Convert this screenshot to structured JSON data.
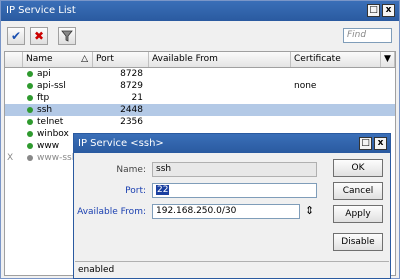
{
  "window": {
    "title": "IP Service List",
    "min_label": "□",
    "close_label": "x"
  },
  "toolbar": {
    "enable_icon": "✔",
    "disable_icon": "✖",
    "filter_icon": "▼",
    "find_placeholder": "Find"
  },
  "table": {
    "columns": [
      "Name",
      "Port",
      "Available From",
      "Certificate"
    ],
    "sort_indicator": "△",
    "dropdown_glyph": "▼",
    "rows": [
      {
        "flag": "",
        "name": "api",
        "port": "8728",
        "from": "",
        "cert": "",
        "status": "enabled"
      },
      {
        "flag": "",
        "name": "api-ssl",
        "port": "8729",
        "from": "",
        "cert": "none",
        "status": "enabled"
      },
      {
        "flag": "",
        "name": "ftp",
        "port": "21",
        "from": "",
        "cert": "",
        "status": "enabled"
      },
      {
        "flag": "",
        "name": "ssh",
        "port": "2448",
        "from": "",
        "cert": "",
        "status": "enabled",
        "selected": true
      },
      {
        "flag": "",
        "name": "telnet",
        "port": "2356",
        "from": "",
        "cert": "",
        "status": "enabled"
      },
      {
        "flag": "",
        "name": "winbox",
        "port": "",
        "from": "",
        "cert": "",
        "status": "enabled"
      },
      {
        "flag": "",
        "name": "www",
        "port": "",
        "from": "",
        "cert": "",
        "status": "enabled"
      },
      {
        "flag": "X",
        "name": "www-ssl",
        "port": "",
        "from": "",
        "cert": "",
        "status": "disabled"
      }
    ]
  },
  "dialog": {
    "title": "IP Service <ssh>",
    "min_label": "□",
    "close_label": "x",
    "name_label": "Name:",
    "name_value": "ssh",
    "port_label": "Port:",
    "port_value": "22",
    "from_label": "Available From:",
    "from_value": "192.168.250.0/30",
    "updown_glyph": "⇕",
    "buttons": {
      "ok": "OK",
      "cancel": "Cancel",
      "apply": "Apply",
      "disable": "Disable"
    },
    "status": "enabled"
  }
}
